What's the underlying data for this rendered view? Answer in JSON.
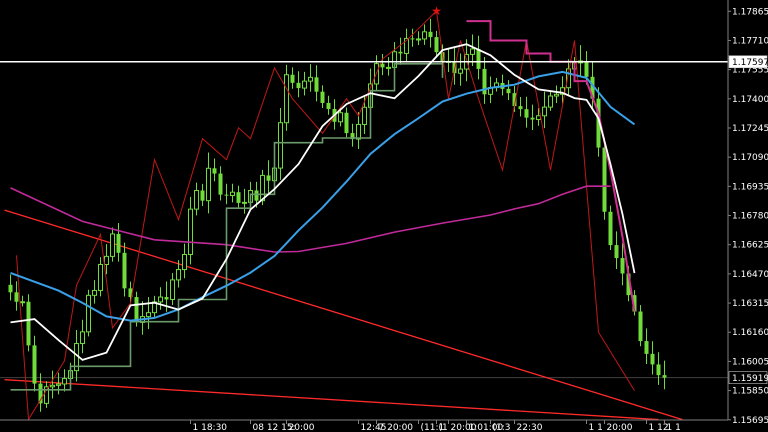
{
  "chart_data": {
    "type": "candlestick",
    "colors": {
      "background": "#000000",
      "candle": "#6fdc3c",
      "axis_text": "#ffffff",
      "grid_line": "#404040",
      "horizontal_level": "#ffffff",
      "ema_fast": "#ffffff",
      "ema_mid": "#3aa0e8",
      "ema_slow": "#c02a9a",
      "trailing_stop": "#6b9a6b",
      "envelope_upper": "#d0308f",
      "zigzag": "#c01818",
      "trendline": "#ff2a2a",
      "marker": "#e01010"
    },
    "y_axis": {
      "ticks": [
        1.17865,
        1.1771,
        1.17555,
        1.174,
        1.17245,
        1.1709,
        1.16935,
        1.1678,
        1.16625,
        1.1647,
        1.16315,
        1.1616,
        1.16005,
        1.1585,
        1.15695
      ],
      "tick_labels": [
        "1.17865",
        "1.17710",
        "1.17555",
        "1.17400",
        "1.17245",
        "1.17090",
        "1.16935",
        "1.16780",
        "1.16625",
        "1.16470",
        "1.16315",
        "1.16160",
        "1.16005",
        "1.15850",
        "1.15695"
      ],
      "range": [
        1.1563,
        1.17925
      ]
    },
    "x_axis": {
      "ticks": [
        {
          "i": 30,
          "label": "1 18:30"
        },
        {
          "i": 40,
          "label": "08 12 15:"
        },
        {
          "i": 46,
          "label": "20:00"
        },
        {
          "i": 58,
          "label": "12:45"
        },
        {
          "i": 61,
          "label": "7 20:00"
        },
        {
          "i": 68,
          "label": "(11:1"
        },
        {
          "i": 71,
          "label": "(1"
        },
        {
          "i": 73,
          "label": "20:00"
        },
        {
          "i": 76,
          "label": "1:01:00"
        },
        {
          "i": 80,
          "label": "(1:3"
        },
        {
          "i": 84,
          "label": "22:30"
        },
        {
          "i": 96,
          "label": "1 1"
        },
        {
          "i": 99,
          "label": "20:00"
        },
        {
          "i": 106,
          "label": "1 12"
        },
        {
          "i": 109,
          "label": "1 1"
        }
      ]
    },
    "horizontal_levels": [
      {
        "value": 1.17597,
        "label": "1.17597"
      },
      {
        "value": 1.15919,
        "label": "1.15919"
      }
    ],
    "closes": [
      1.16372,
      1.16322,
      1.16322,
      1.1609,
      1.15887,
      1.15782,
      1.1587,
      1.15878,
      1.15885,
      1.15914,
      1.15956,
      1.161,
      1.16162,
      1.16356,
      1.16382,
      1.1652,
      1.16563,
      1.16682,
      1.16582,
      1.16393,
      1.16347,
      1.16212,
      1.16243,
      1.16264,
      1.16321,
      1.16347,
      1.16334,
      1.16438,
      1.16493,
      1.16573,
      1.16814,
      1.16913,
      1.16859,
      1.17031,
      1.17003,
      1.16891,
      1.16886,
      1.16904,
      1.16847,
      1.1685,
      1.16913,
      1.16859,
      1.16993,
      1.16965,
      1.17032,
      1.17273,
      1.17528,
      1.17485,
      1.17457,
      1.17494,
      1.17514,
      1.17438,
      1.17378,
      1.17346,
      1.17278,
      1.17326,
      1.17218,
      1.17186,
      1.17264,
      1.17355,
      1.17479,
      1.17587,
      1.17567,
      1.17567,
      1.1765,
      1.17641,
      1.17721,
      1.17718,
      1.17718,
      1.17756,
      1.17728,
      1.17648,
      1.17599,
      1.17599,
      1.17536,
      1.17558,
      1.17636,
      1.17665,
      1.17559,
      1.17424,
      1.1746,
      1.17484,
      1.17453,
      1.1743,
      1.17361,
      1.17345,
      1.173,
      1.1729,
      1.1731,
      1.17356,
      1.17415,
      1.17424,
      1.17459,
      1.17559,
      1.17591,
      1.17601,
      1.17517,
      1.17401,
      1.17141,
      1.168,
      1.16623,
      1.16554,
      1.16472,
      1.16357,
      1.1627,
      1.16113,
      1.16045,
      1.15989,
      1.15932,
      1.15919
    ],
    "indicators": {
      "ema_fast": [
        [
          0,
          1.16212
        ],
        [
          4,
          1.1623
        ],
        [
          8,
          1.16118
        ],
        [
          12,
          1.16013
        ],
        [
          16,
          1.16052
        ],
        [
          20,
          1.16303
        ],
        [
          24,
          1.16317
        ],
        [
          28,
          1.1628
        ],
        [
          32,
          1.16339
        ],
        [
          36,
          1.16549
        ],
        [
          40,
          1.16812
        ],
        [
          44,
          1.16921
        ],
        [
          48,
          1.17053
        ],
        [
          52,
          1.17255
        ],
        [
          56,
          1.17372
        ],
        [
          60,
          1.1743
        ],
        [
          64,
          1.17403
        ],
        [
          68,
          1.17521
        ],
        [
          72,
          1.17659
        ],
        [
          76,
          1.1769
        ],
        [
          80,
          1.17631
        ],
        [
          84,
          1.17527
        ],
        [
          88,
          1.1745
        ],
        [
          92,
          1.17432
        ],
        [
          94,
          1.17404
        ],
        [
          96,
          1.17395
        ],
        [
          98,
          1.17296
        ],
        [
          100,
          1.17052
        ],
        [
          102,
          1.16787
        ],
        [
          104,
          1.16474
        ]
      ],
      "ema_mid": [
        [
          0,
          1.16475
        ],
        [
          8,
          1.16381
        ],
        [
          12,
          1.16316
        ],
        [
          16,
          1.16244
        ],
        [
          20,
          1.16222
        ],
        [
          24,
          1.16236
        ],
        [
          28,
          1.16281
        ],
        [
          32,
          1.16346
        ],
        [
          36,
          1.16407
        ],
        [
          40,
          1.16477
        ],
        [
          44,
          1.16565
        ],
        [
          48,
          1.16701
        ],
        [
          52,
          1.16822
        ],
        [
          56,
          1.1696
        ],
        [
          60,
          1.17108
        ],
        [
          64,
          1.17212
        ],
        [
          68,
          1.17297
        ],
        [
          72,
          1.17386
        ],
        [
          76,
          1.17427
        ],
        [
          80,
          1.17458
        ],
        [
          84,
          1.17475
        ],
        [
          88,
          1.17519
        ],
        [
          92,
          1.17543
        ],
        [
          96,
          1.17511
        ],
        [
          100,
          1.17357
        ],
        [
          104,
          1.17264
        ]
      ],
      "ema_slow": [
        [
          0,
          1.16927
        ],
        [
          12,
          1.16749
        ],
        [
          24,
          1.16651
        ],
        [
          36,
          1.16625
        ],
        [
          44,
          1.16586
        ],
        [
          48,
          1.16589
        ],
        [
          56,
          1.16632
        ],
        [
          64,
          1.16692
        ],
        [
          72,
          1.1674
        ],
        [
          80,
          1.16783
        ],
        [
          84,
          1.16815
        ],
        [
          88,
          1.16843
        ],
        [
          92,
          1.16893
        ],
        [
          96,
          1.16936
        ],
        [
          100,
          1.16936
        ]
      ],
      "trailing_stop": [
        [
          0,
          1.15854
        ],
        [
          10,
          1.15854
        ],
        [
          10,
          1.15979
        ],
        [
          20,
          1.15979
        ],
        [
          20,
          1.16216
        ],
        [
          28,
          1.16216
        ],
        [
          28,
          1.16334
        ],
        [
          36,
          1.16334
        ],
        [
          36,
          1.16819
        ],
        [
          40,
          1.16819
        ],
        [
          40,
          1.16893
        ],
        [
          44,
          1.16893
        ],
        [
          44,
          1.17167
        ],
        [
          52,
          1.17167
        ],
        [
          52,
          1.17192
        ],
        [
          60,
          1.17192
        ],
        [
          60,
          1.17443
        ],
        [
          64,
          1.17443
        ],
        [
          64,
          1.17586
        ],
        [
          72,
          1.17586
        ],
        [
          72,
          1.17511
        ]
      ],
      "envelope_upper": [
        [
          76,
          1.17813
        ],
        [
          80,
          1.17813
        ],
        [
          80,
          1.1771
        ],
        [
          86,
          1.1771
        ],
        [
          86,
          1.17641
        ],
        [
          90,
          1.17641
        ],
        [
          90,
          1.17597
        ],
        [
          94,
          1.17597
        ],
        [
          94,
          1.17494
        ],
        [
          96,
          1.17494
        ],
        [
          98,
          1.17322
        ],
        [
          100,
          1.17019
        ],
        [
          102,
          1.16667
        ],
        [
          104,
          1.1627
        ]
      ]
    },
    "zigzag": [
      [
        1,
        1.16568
      ],
      [
        3,
        1.15697
      ],
      [
        9,
        1.16009
      ],
      [
        11,
        1.16409
      ],
      [
        15,
        1.1668
      ],
      [
        17,
        1.16183
      ],
      [
        20,
        1.16314
      ],
      [
        24,
        1.17077
      ],
      [
        28,
        1.16758
      ],
      [
        32,
        1.17188
      ],
      [
        36,
        1.17077
      ],
      [
        38,
        1.17246
      ],
      [
        40,
        1.17188
      ],
      [
        44,
        1.17564
      ],
      [
        47,
        1.174
      ],
      [
        52,
        1.17217
      ],
      [
        56,
        1.174
      ],
      [
        58,
        1.1731
      ],
      [
        62,
        1.17612
      ],
      [
        66,
        1.1771
      ],
      [
        71,
        1.17867
      ],
      [
        73,
        1.174
      ],
      [
        75,
        1.1771
      ],
      [
        78,
        1.174
      ],
      [
        82,
        1.17022
      ],
      [
        86,
        1.1771
      ],
      [
        90,
        1.17022
      ],
      [
        94,
        1.1771
      ],
      [
        98,
        1.1616
      ],
      [
        104,
        1.1585
      ]
    ],
    "trendlines": [
      {
        "start": [
          -1,
          1.16809
        ],
        "end": [
          112,
          1.15696
        ]
      },
      {
        "start": [
          -1,
          1.15908
        ],
        "end": [
          108,
          1.15696
        ]
      }
    ],
    "marker": {
      "i": 71,
      "value": 1.17867,
      "symbol": "★"
    }
  }
}
